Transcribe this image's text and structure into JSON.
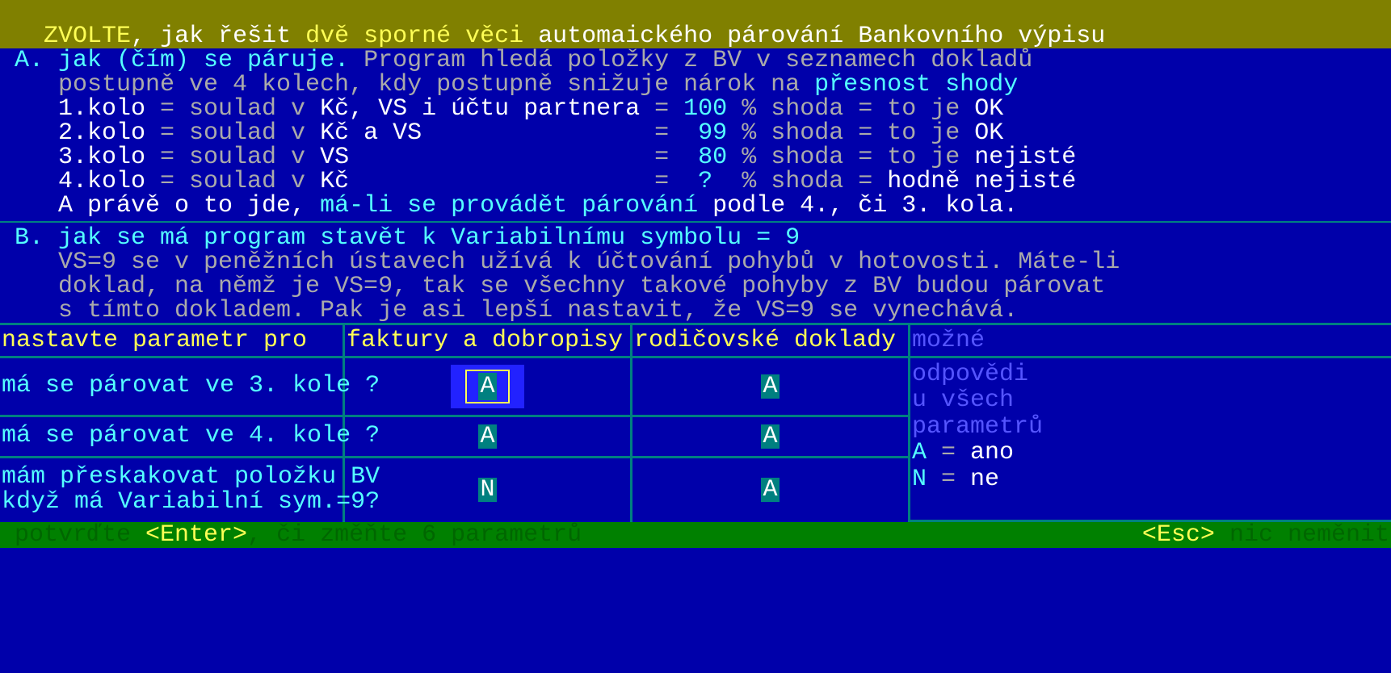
{
  "title": {
    "lead": " ZVOLTE",
    "sep": ", ",
    "mid1": "jak řešit ",
    "mid2": "dvě sporné věci ",
    "tail": "automaického párování Bankovního výpisu"
  },
  "secA": {
    "head_a": "A. ",
    "head_b": "jak (čím) se páruje. ",
    "head_c": "Program hledá položky z BV v seznamech dokladů",
    "line2a": "postupně ve 4 kolech, kdy postupně snižuje nárok na ",
    "line2b": "přesnost shody",
    "r1": {
      "k": "1.kolo ",
      "eq": "= soulad v ",
      "f": "Kč, VS i účtu partnera ",
      "eq2": "= ",
      "p": "100 ",
      "s": "% shoda = to je ",
      "v": "OK"
    },
    "r2": {
      "k": "2.kolo ",
      "eq": "= soulad v ",
      "f": "Kč a VS                ",
      "eq2": "=  ",
      "p": "99 ",
      "s": "% shoda = to je ",
      "v": "OK"
    },
    "r3": {
      "k": "3.kolo ",
      "eq": "= soulad v ",
      "f": "VS                     ",
      "eq2": "=  ",
      "p": "80 ",
      "s": "% shoda = to je ",
      "v": "nejisté"
    },
    "r4": {
      "k": "4.kolo ",
      "eq": "= soulad v ",
      "f": "Kč                     ",
      "eq2": "=  ",
      "p": "?  ",
      "s": "% shoda = ",
      "v": "hodně nejisté"
    },
    "foot_a": "A právě o to jde, ",
    "foot_b": "má-li se provádět párování ",
    "foot_c": "podle 4., či 3. kola."
  },
  "secB": {
    "head_a": "B. ",
    "head_b": "jak se má program stavět k Variabilnímu symbolu = 9",
    "l1": "VS=9 se v peněžních ústavech užívá k účtování pohybů v hotovosti. Máte-li",
    "l2": "doklad, na němž je VS=9, tak se všechny takové pohyby z BV budou párovat",
    "l3": "s tímto dokladem. Pak je asi lepší nastavit, že VS=9 se vynechává."
  },
  "table": {
    "h1": "nastavte parametr pro",
    "h2": "faktury a dobropisy",
    "h3": "rodičovské doklady",
    "h4a": "možné",
    "h4b": "odpovědi",
    "h4c": "u všech",
    "h4d": "parametrů",
    "legA": "A ",
    "legA2": "= ",
    "legA3": "ano",
    "legN": "N ",
    "legN2": "= ",
    "legN3": "ne",
    "rows": [
      {
        "label": "má se párovat ve 3. kole ?",
        "c1": "A",
        "c2": "A",
        "focus": true
      },
      {
        "label": "má se párovat ve 4. kole ?",
        "c1": "A",
        "c2": "A",
        "focus": false
      },
      {
        "label": "mám přeskakovat položku BV\nkdyž má Variabilní sym.=9?",
        "c1": "N",
        "c2": "A",
        "focus": false
      }
    ]
  },
  "status": {
    "l1": "potvrďte ",
    "l2": "<Enter>",
    "l3": ", či změňte 6 parametrů",
    "r1": "<Esc> ",
    "r2": "nic neměnit"
  }
}
